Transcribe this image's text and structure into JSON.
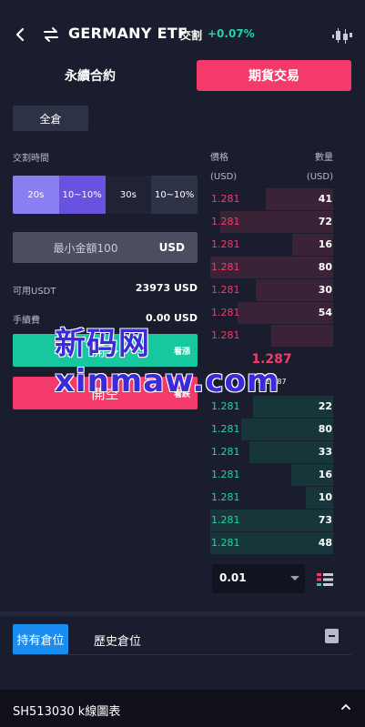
{
  "header": {
    "title": "GERMANY ETF",
    "trade_label": "交割",
    "change": "+0.07%",
    "back_icon": "chevron-left-icon",
    "swap_icon": "swap-arrows-icon",
    "chart_icon": "candlestick-icon"
  },
  "tabs": {
    "perpetual": "永續合約",
    "futures": "期貨交易"
  },
  "margin_mode": "全倉",
  "delivery": {
    "label": "交割時間",
    "options": [
      {
        "time": "20s",
        "rate": "10~10%"
      },
      {
        "time": "30s",
        "rate": "10~10%"
      }
    ]
  },
  "amount": {
    "placeholder": "最小金額100",
    "unit": "USD"
  },
  "balance": {
    "available_label": "可用USDT",
    "available_value": "23973 USD",
    "fee_label": "手續費",
    "fee_value": "0.00 USD"
  },
  "actions": {
    "long_label": "開多",
    "long_sub": "看漲",
    "short_label": "開空",
    "short_sub": "看跌"
  },
  "order_book": {
    "price_header": "價格",
    "qty_header": "數量",
    "price_unit": "(USD)",
    "qty_unit": "(USD)",
    "asks": [
      {
        "price": "1.281",
        "qty": "41",
        "depth": 0.55
      },
      {
        "price": "1.281",
        "qty": "72",
        "depth": 0.92
      },
      {
        "price": "1.281",
        "qty": "16",
        "depth": 0.33
      },
      {
        "price": "1.281",
        "qty": "80",
        "depth": 1.0
      },
      {
        "price": "1.281",
        "qty": "30",
        "depth": 0.63
      },
      {
        "price": "1.281",
        "qty": "54",
        "depth": 0.78
      },
      {
        "price": "1.281",
        "qty": "",
        "depth": 0.5
      }
    ],
    "mid_price": "1.287",
    "mid_sub": "≈ 1.287",
    "bids": [
      {
        "price": "1.281",
        "qty": "22",
        "depth": 0.65
      },
      {
        "price": "1.281",
        "qty": "80",
        "depth": 0.75
      },
      {
        "price": "1.281",
        "qty": "33",
        "depth": 0.68
      },
      {
        "price": "1.281",
        "qty": "16",
        "depth": 0.34
      },
      {
        "price": "1.281",
        "qty": "10",
        "depth": 0.22
      },
      {
        "price": "1.281",
        "qty": "73",
        "depth": 1.0
      },
      {
        "price": "1.281",
        "qty": "48",
        "depth": 1.0
      }
    ],
    "precision": "0.01",
    "layout_icon": "orderbook-layout-icon"
  },
  "watermark": "新码网xinmaw.com",
  "positions": {
    "active_tab": "持有倉位",
    "history_tab": "歷史倉位",
    "doc_icon": "document-icon"
  },
  "footer": {
    "label": "SH513030  k線圖表",
    "caret_icon": "chevron-up-icon"
  },
  "colors": {
    "background": "#1a1d2e",
    "red": "#f43a6b",
    "green": "#22d3a4",
    "blue": "#1a8ef0",
    "purple": "#6a52e0"
  }
}
